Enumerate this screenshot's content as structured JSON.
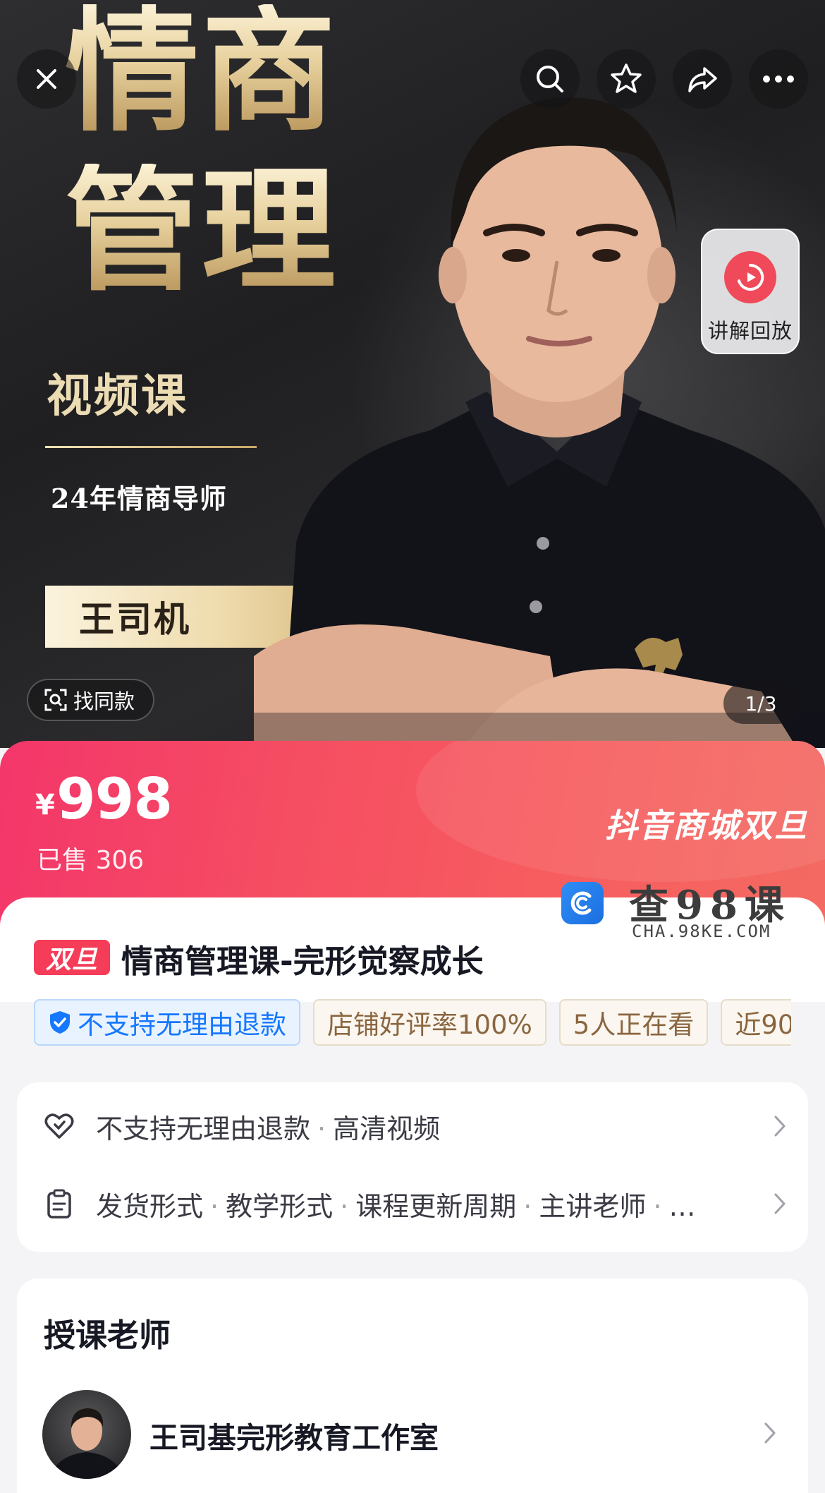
{
  "hero": {
    "title_line1": "情商",
    "title_line2": "管理",
    "subtitle": "视频课",
    "tagline": "24年情商导师",
    "instructor_name": "王司机",
    "replay_label": "讲解回放",
    "find_similar_label": "找同款",
    "image_counter": "1/3"
  },
  "price": {
    "currency": "¥",
    "amount": "998",
    "sold": "已售 306",
    "festival": "抖音商城双旦"
  },
  "watermark": {
    "title": "查98课",
    "subtitle": "CHA.98KE.COM"
  },
  "product": {
    "tag": "双旦",
    "title": "情商管理课-完形觉察成长",
    "chips": [
      "不支持无理由退款",
      "店铺好评率100%",
      "5人正在看",
      "近90"
    ]
  },
  "services": {
    "row1": [
      "不支持无理由退款",
      "高清视频"
    ],
    "row2": [
      "发货形式",
      "教学形式",
      "课程更新周期",
      "主讲老师",
      "…"
    ],
    "separator": "·"
  },
  "teacher": {
    "section_title": "授课老师",
    "name": "王司基完形教育工作室"
  },
  "colors": {
    "accent_red": "#f53c58",
    "blue_chip": "#1677ff",
    "gold": "#e6cf9b"
  }
}
